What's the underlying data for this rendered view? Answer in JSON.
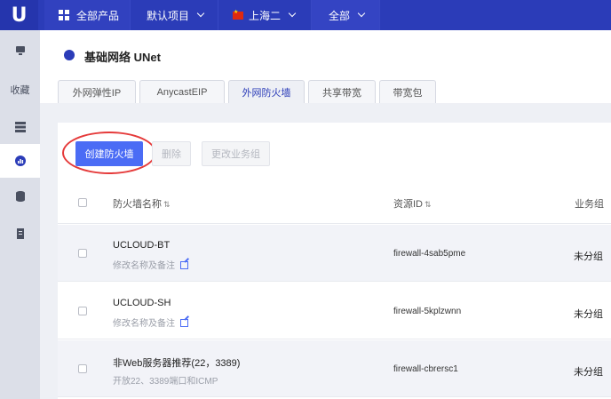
{
  "topbar": {
    "logo": "U",
    "all_products": "全部产品",
    "project": "默认项目",
    "region": "上海二",
    "zone": "全部"
  },
  "sidebar": {
    "favorites_label": "收藏"
  },
  "page": {
    "title": "基础网络 UNet"
  },
  "tabs": [
    {
      "label": "外网弹性IP"
    },
    {
      "label": "AnycastEIP"
    },
    {
      "label": "外网防火墙"
    },
    {
      "label": "共享带宽"
    },
    {
      "label": "带宽包"
    }
  ],
  "toolbar": {
    "create_label": "创建防火墙",
    "delete_label": "删除",
    "change_group_label": "更改业务组"
  },
  "table": {
    "columns": [
      "防火墙名称",
      "资源ID",
      "业务组"
    ],
    "sort_glyph": "⇅",
    "rows": [
      {
        "name": "UCLOUD-BT",
        "remark": "修改名称及备注",
        "resource_id": "firewall-4sab5pme",
        "group": "未分组"
      },
      {
        "name": "UCLOUD-SH",
        "remark": "修改名称及备注",
        "resource_id": "firewall-5kplzwnn",
        "group": "未分组"
      },
      {
        "name": "非Web服务器推荐(22，3389)",
        "remark": "开放22、3389端口和ICMP",
        "resource_id": "firewall-cbrersc1",
        "group": "未分组"
      }
    ]
  },
  "colors": {
    "topbar": "#2b3cb8",
    "primary_button": "#4b6cf5",
    "highlight_circle": "#e53a3a"
  }
}
